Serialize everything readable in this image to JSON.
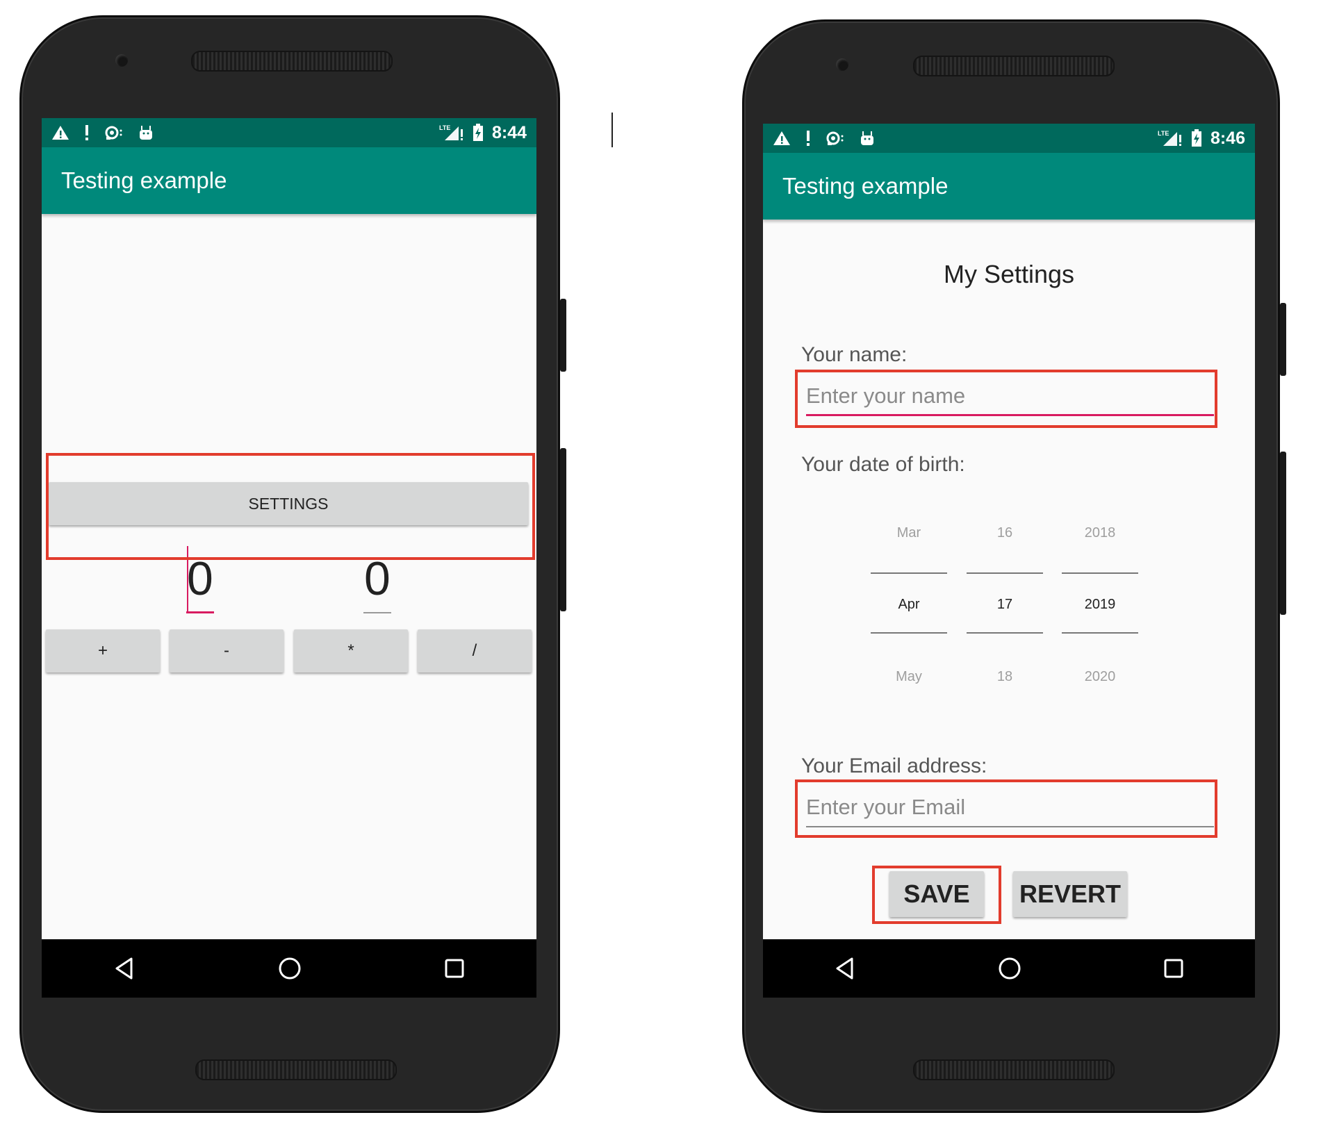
{
  "left_phone": {
    "status": {
      "time": "8:44",
      "net": "LTE"
    },
    "appbar_title": "Testing example",
    "settings_button": "SETTINGS",
    "operand1": "0",
    "operand2": "0",
    "operators": [
      "+",
      "-",
      "*",
      "/"
    ]
  },
  "right_phone": {
    "status": {
      "time": "8:46",
      "net": "LTE"
    },
    "appbar_title": "Testing example",
    "heading": "My Settings",
    "name_label": "Your name:",
    "name_placeholder": "Enter your name",
    "dob_label": "Your date of birth:",
    "date_picker": {
      "month": {
        "prev": "Mar",
        "selected": "Apr",
        "next": "May"
      },
      "day": {
        "prev": "16",
        "selected": "17",
        "next": "18"
      },
      "year": {
        "prev": "2018",
        "selected": "2019",
        "next": "2020"
      }
    },
    "email_label": "Your Email address:",
    "email_placeholder": "Enter your Email",
    "save_button": "SAVE",
    "revert_button": "REVERT"
  },
  "colors": {
    "status_bar": "#00695c",
    "app_bar": "#00897b",
    "accent": "#d81b60",
    "highlight_box": "#e23c2d"
  }
}
